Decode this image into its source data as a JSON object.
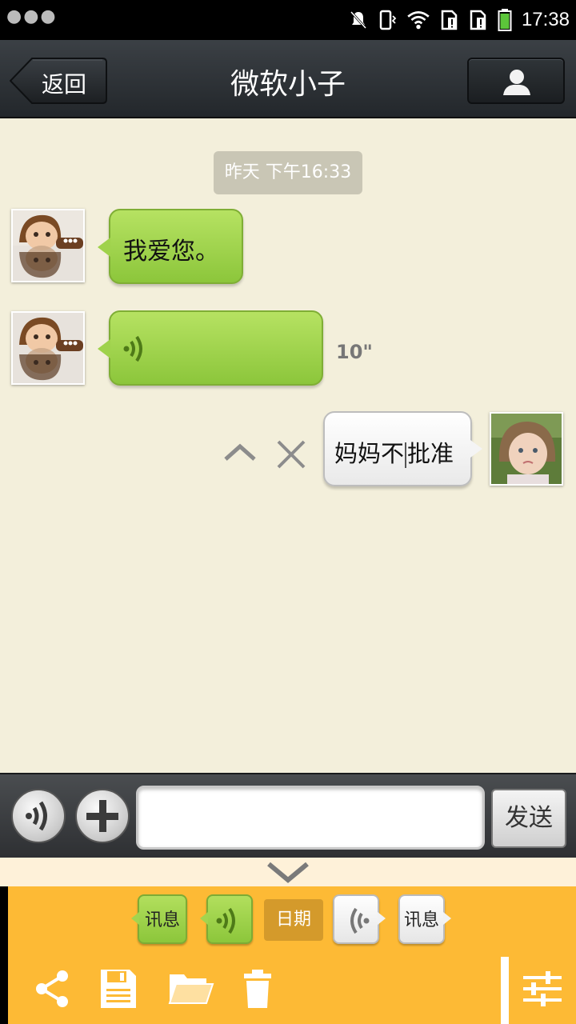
{
  "status_bar": {
    "time": "17:38",
    "icons": [
      "more-dots-icon",
      "muted-bell-icon",
      "vibrate-icon",
      "wifi-icon",
      "sim-alert-icon",
      "sim-alert-icon",
      "battery-icon"
    ]
  },
  "header": {
    "back_label": "返回",
    "title": "微软小子",
    "profile_icon": "person-icon"
  },
  "chat": {
    "timestamp": "昨天 下午16:33",
    "messages": [
      {
        "side": "left",
        "type": "text",
        "text": "我爱您。"
      },
      {
        "side": "left",
        "type": "voice",
        "duration": "10\""
      },
      {
        "side": "right",
        "type": "text",
        "text_before_cursor": "妈妈不",
        "text_after_cursor": "批准"
      }
    ]
  },
  "input_bar": {
    "voice_icon": "voice-icon",
    "add_icon": "plus-icon",
    "input_value": "",
    "send_label": "发送"
  },
  "panel": {
    "chips": [
      "讯息",
      "日期",
      "讯息"
    ],
    "tools": [
      "share-icon",
      "save-icon",
      "folder-icon",
      "trash-icon",
      "settings-sliders-icon"
    ]
  },
  "colors": {
    "chat_bg": "#f3efdb",
    "green_bubble": "#9fd24b",
    "panel_bg": "#fdba35",
    "header_bg": "#2c3034"
  }
}
